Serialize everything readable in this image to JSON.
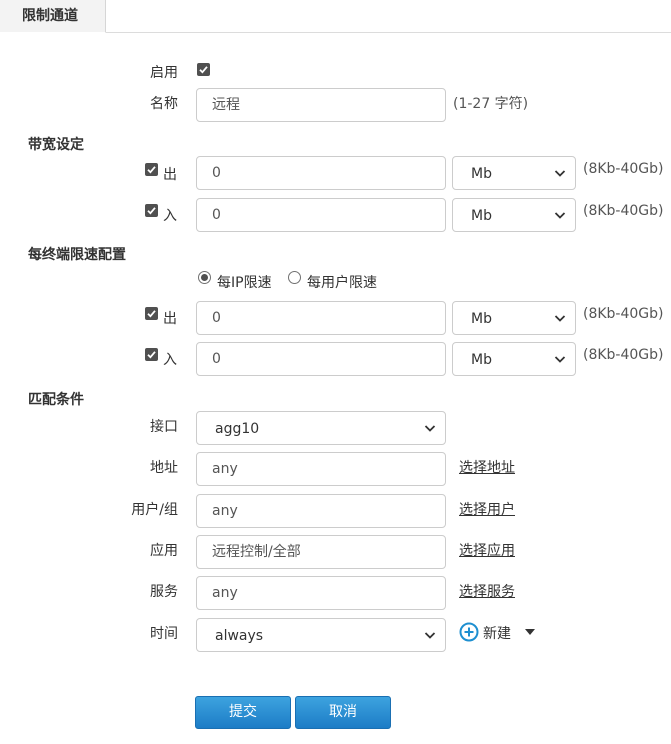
{
  "tab": {
    "label": "限制通道"
  },
  "general": {
    "enable_label": "启用",
    "enable_checked": true,
    "name_label": "名称",
    "name_value": "远程",
    "name_hint": "(1-27 字符)"
  },
  "bandwidth": {
    "section_title": "带宽设定",
    "out_label": "出",
    "out_checked": true,
    "out_value": "0",
    "out_unit": "Mb",
    "in_label": "入",
    "in_checked": true,
    "in_value": "0",
    "in_unit": "Mb",
    "range_hint": "(8Kb-40Gb)"
  },
  "per_terminal": {
    "section_title": "每终端限速配置",
    "mode_options": [
      "每IP限速",
      "每用户限速"
    ],
    "mode_selected": "每IP限速",
    "out_label": "出",
    "out_checked": true,
    "out_value": "0",
    "out_unit": "Mb",
    "in_label": "入",
    "in_checked": true,
    "in_value": "0",
    "in_unit": "Mb",
    "range_hint": "(8Kb-40Gb)"
  },
  "match": {
    "section_title": "匹配条件",
    "interface_label": "接口",
    "interface_value": "agg10",
    "address_label": "地址",
    "address_value": "any",
    "address_link": "选择地址",
    "user_label": "用户/组",
    "user_value": "any",
    "user_link": "选择用户",
    "app_label": "应用",
    "app_value": "远程控制/全部",
    "app_link": "选择应用",
    "service_label": "服务",
    "service_value": "any",
    "service_link": "选择服务",
    "time_label": "时间",
    "time_value": "always",
    "new_label": "新建"
  },
  "actions": {
    "submit_label": "提交",
    "cancel_label": "取消"
  },
  "colors": {
    "button_blue": "#2a8fd4",
    "add_icon": "#1e8fd0",
    "checkbox": "#505050"
  }
}
